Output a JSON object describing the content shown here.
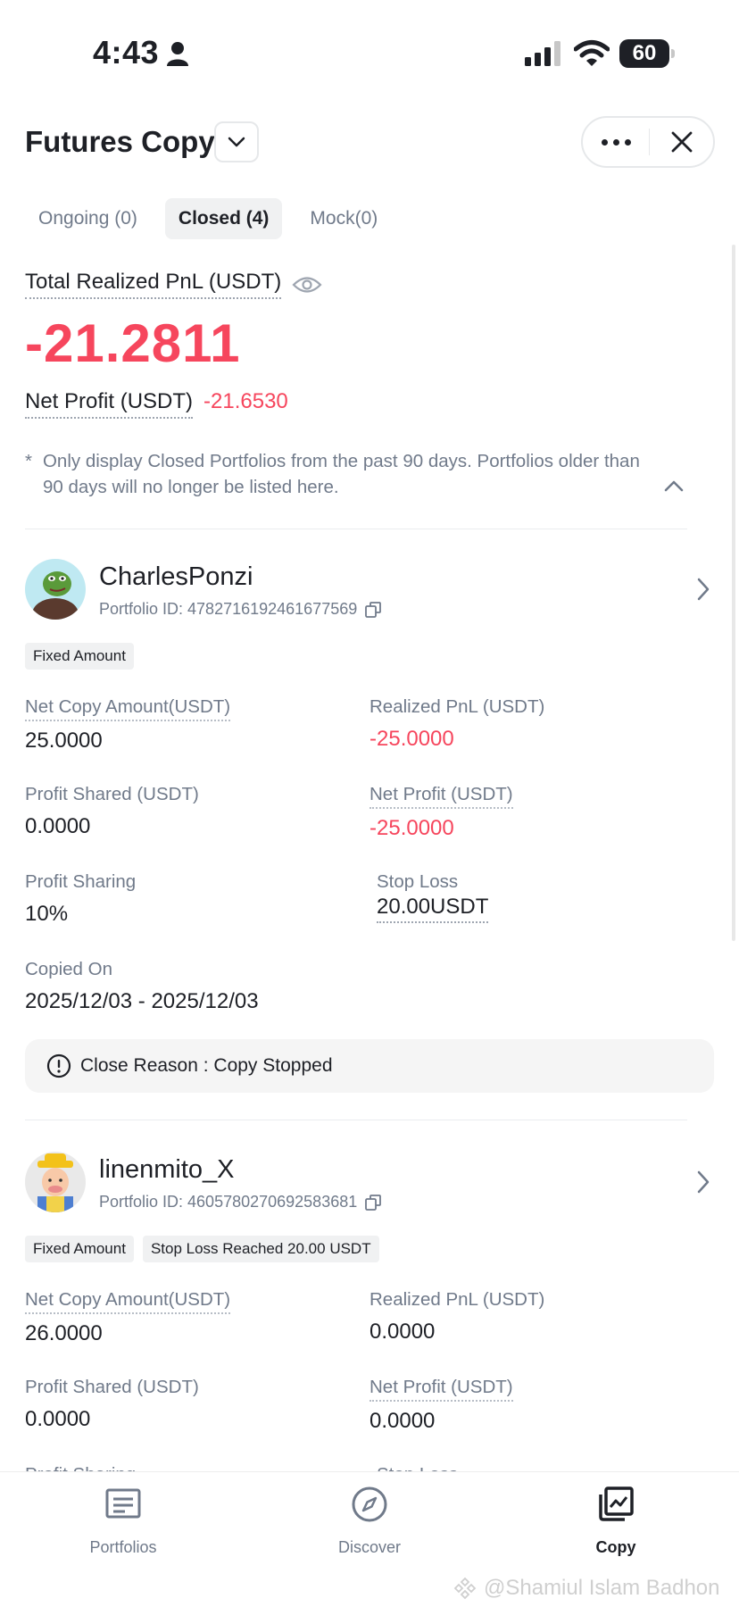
{
  "status_bar": {
    "time": "4:43",
    "battery": "60"
  },
  "header": {
    "title": "Futures Copy"
  },
  "tabs": [
    {
      "label": "Ongoing (0)",
      "active": false
    },
    {
      "label": "Closed (4)",
      "active": true
    },
    {
      "label": "Mock(0)",
      "active": false
    }
  ],
  "summary": {
    "total_label": "Total Realized PnL (USDT)",
    "total_value": "-21.2811",
    "net_label": "Net Profit (USDT)",
    "net_value": "-21.6530",
    "notice_star": "*",
    "notice": "Only display Closed Portfolios from the past 90 days. Portfolios older than 90 days will no longer be listed here."
  },
  "portfolios": [
    {
      "trader": "CharlesPonzi",
      "portfolio_id": "Portfolio ID: 4782716192461677569",
      "tags": [
        "Fixed Amount"
      ],
      "net_copy_amount_label": "Net Copy Amount(USDT)",
      "net_copy_amount": "25.0000",
      "realized_pnl_label": "Realized PnL (USDT)",
      "realized_pnl": "-25.0000",
      "profit_shared_label": "Profit Shared (USDT)",
      "profit_shared": "0.0000",
      "net_profit_label": "Net Profit (USDT)",
      "net_profit": "-25.0000",
      "profit_sharing_label": "Profit Sharing",
      "profit_sharing": "10%",
      "stop_loss_label": "Stop Loss",
      "stop_loss": "20.00USDT",
      "copied_on_label": "Copied On",
      "copied_on": "2025/12/03 - 2025/12/03",
      "close_reason": "Close Reason : Copy Stopped"
    },
    {
      "trader": "linenmito_X",
      "portfolio_id": "Portfolio ID: 4605780270692583681",
      "tags": [
        "Fixed Amount",
        "Stop Loss Reached 20.00 USDT"
      ],
      "net_copy_amount_label": "Net Copy Amount(USDT)",
      "net_copy_amount": "26.0000",
      "realized_pnl_label": "Realized PnL (USDT)",
      "realized_pnl": "0.0000",
      "profit_shared_label": "Profit Shared (USDT)",
      "profit_shared": "0.0000",
      "net_profit_label": "Net Profit (USDT)",
      "net_profit": "0.0000",
      "profit_sharing_label": "Profit Sharing",
      "stop_loss_label": "Stop Loss"
    }
  ],
  "bottom_nav": [
    {
      "label": "Portfolios",
      "icon": "portfolios-icon",
      "active": false
    },
    {
      "label": "Discover",
      "icon": "compass-icon",
      "active": false
    },
    {
      "label": "Copy",
      "icon": "copy-chart-icon",
      "active": true
    }
  ],
  "watermark": "@Shamiul Islam Badhon",
  "colors": {
    "negative": "#f6465d",
    "text": "#1e2026",
    "muted": "#707a8a"
  }
}
